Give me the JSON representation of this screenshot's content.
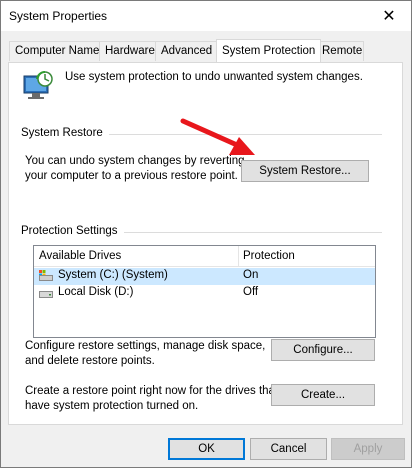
{
  "window": {
    "title": "System Properties",
    "close_glyph": "✕"
  },
  "tabs": [
    {
      "label": "Computer Name"
    },
    {
      "label": "Hardware"
    },
    {
      "label": "Advanced"
    },
    {
      "label": "System Protection",
      "active": true
    },
    {
      "label": "Remote"
    }
  ],
  "intro": {
    "text": "Use system protection to undo unwanted system changes.",
    "icon": "system-protection-icon"
  },
  "system_restore": {
    "group_label": "System Restore",
    "description_line1": "You can undo system changes by reverting",
    "description_line2": "your computer to a previous restore point.",
    "button_label": "System Restore..."
  },
  "protection_settings": {
    "group_label": "Protection Settings",
    "columns": [
      "Available Drives",
      "Protection"
    ],
    "drives": [
      {
        "name": "System (C:) (System)",
        "protection": "On",
        "icon": "system-drive-icon",
        "selected": true
      },
      {
        "name": "Local Disk (D:)",
        "protection": "Off",
        "icon": "disk-drive-icon",
        "selected": false
      }
    ],
    "configure_line1": "Configure restore settings, manage disk space,",
    "configure_line2": "and delete restore points.",
    "configure_button": "Configure...",
    "create_line1": "Create a restore point right now for the drives that",
    "create_line2": "have system protection turned on.",
    "create_button": "Create..."
  },
  "footer": {
    "ok": "OK",
    "cancel": "Cancel",
    "apply": "Apply"
  },
  "annotation": {
    "arrow_color": "#e8171c"
  }
}
